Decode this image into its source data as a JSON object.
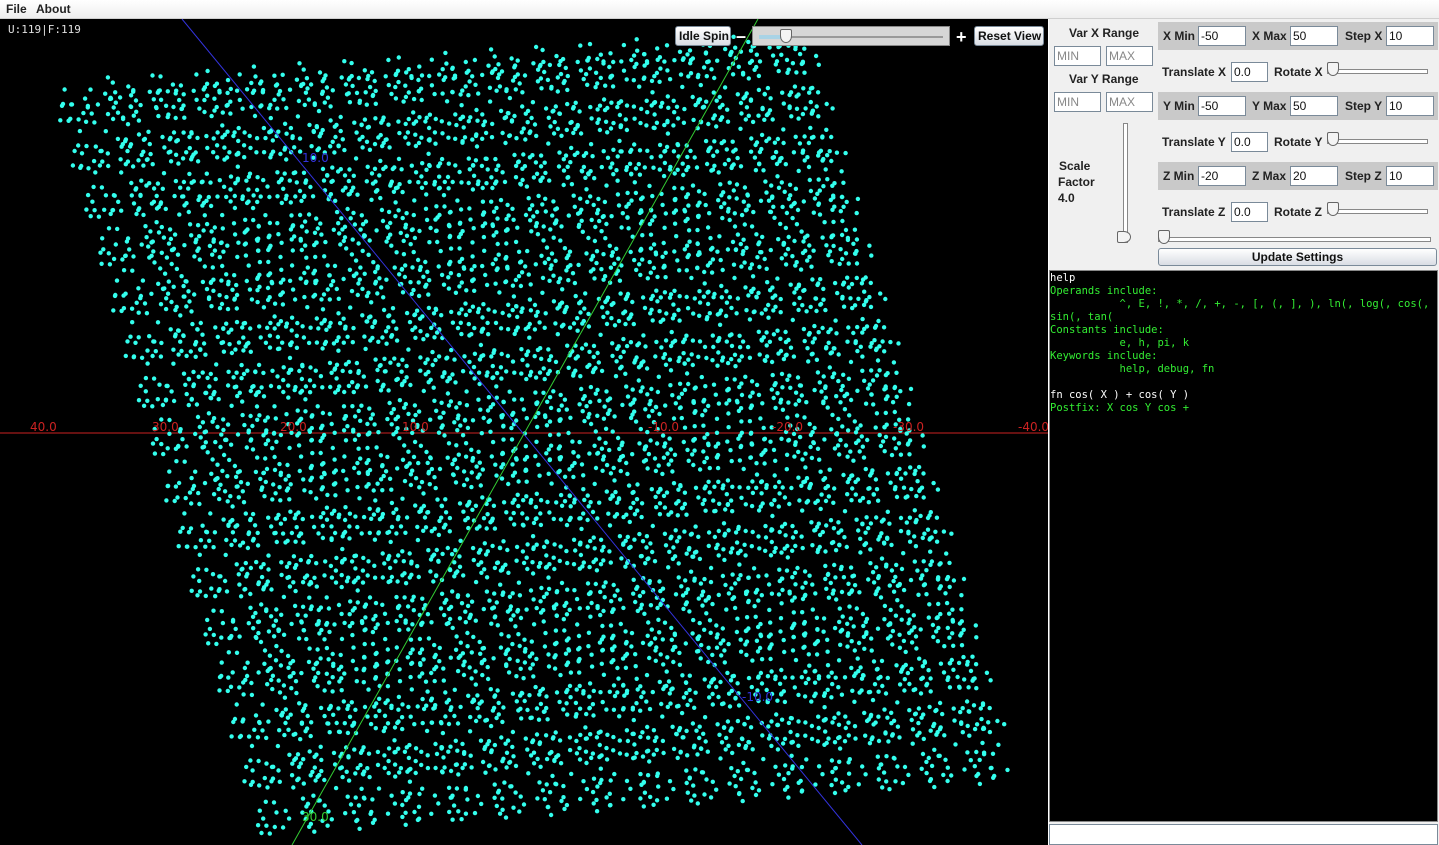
{
  "menu": {
    "items": [
      "File",
      "About"
    ]
  },
  "plot": {
    "counter": "U:119|F:119",
    "idle_spin_label": "Idle Spin",
    "minus": "–",
    "plus": "+",
    "reset_view_label": "Reset View",
    "spin_level": 0.12,
    "x_axis_ticks": [
      "40.0",
      "30.0",
      "20.0",
      "10.0",
      "-10.0",
      "-20.0",
      "-30.0",
      "-40.0"
    ],
    "z_axis_ticks": [
      "10.0",
      "-10.0"
    ],
    "y_axis_ticks": [
      "30.0"
    ],
    "colors": {
      "points": "#33ffee",
      "x_axis": "#cc2222",
      "z_axis": "#3333dd",
      "y_axis": "#33cc33",
      "background": "#000000"
    }
  },
  "controls": {
    "var_x_range": "Var X Range",
    "var_y_range": "Var Y Range",
    "min_placeholder": "MIN",
    "max_placeholder": "MAX",
    "scale_factor_lines": [
      "Scale",
      "Factor",
      "4.0"
    ],
    "scale_level": 0.0,
    "x": {
      "min_label": "X Min",
      "min": "-50",
      "max_label": "X Max",
      "max": "50",
      "step_label": "Step X",
      "step": "10",
      "translate_label": "Translate X",
      "translate": "0.0",
      "rotate_label": "Rotate X",
      "rotate_level": 0.0
    },
    "y": {
      "min_label": "Y Min",
      "min": "-50",
      "max_label": "Y Max",
      "max": "50",
      "step_label": "Step Y",
      "step": "10",
      "translate_label": "Translate Y",
      "translate": "0.0",
      "rotate_label": "Rotate Y",
      "rotate_level": 0.0
    },
    "z": {
      "min_label": "Z Min",
      "min": "-20",
      "max_label": "Z Max",
      "max": "20",
      "step_label": "Step Z",
      "step": "10",
      "translate_label": "Translate Z",
      "translate": "0.0",
      "rotate_label": "Rotate Z",
      "rotate_level": 0.0
    },
    "bottom_slider_level": 0.0,
    "update_label": "Update Settings"
  },
  "console": {
    "help_cmd": "help",
    "lines": [
      "Operands include:",
      "           ^, E, !, *, /, +, -, [, (, ], ), ln(, log(, cos(,",
      "sin(, tan(",
      "Constants include:",
      "           e, h, pi, k",
      "Keywords include:",
      "           help, debug, fn"
    ],
    "fn_cmd": "fn cos( X ) + cos( Y )",
    "postfix": "Postfix: X cos Y cos +"
  }
}
